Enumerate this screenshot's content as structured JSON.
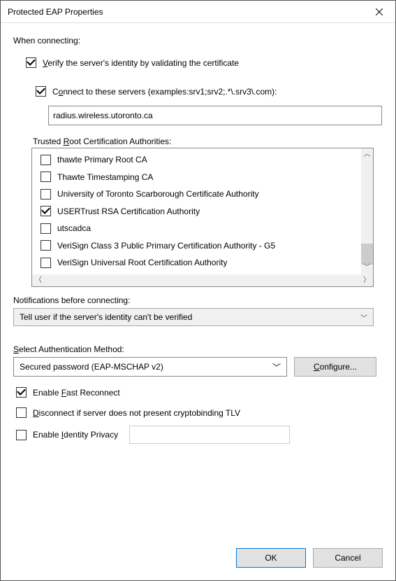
{
  "title": "Protected EAP Properties",
  "whenConnecting": "When connecting:",
  "verify": {
    "checked": true,
    "pre": "",
    "u": "V",
    "post": "erify the server's identity by validating the certificate"
  },
  "connectServers": {
    "checked": true,
    "pre": "C",
    "u": "o",
    "post": "nnect to these servers (examples:srv1;srv2;.*\\.srv3\\.com):"
  },
  "serversValue": "radius.wireless.utoronto.ca",
  "trustedRootLabel": {
    "pre": "Trusted ",
    "u": "R",
    "post": "oot Certification Authorities:"
  },
  "caList": [
    {
      "checked": false,
      "label": "thawte Primary Root CA"
    },
    {
      "checked": false,
      "label": "Thawte Timestamping CA"
    },
    {
      "checked": false,
      "label": "University of Toronto Scarborough Certificate Authority"
    },
    {
      "checked": true,
      "label": "USERTrust RSA Certification Authority"
    },
    {
      "checked": false,
      "label": "utscadca"
    },
    {
      "checked": false,
      "label": "VeriSign Class 3 Public Primary Certification Authority - G5"
    },
    {
      "checked": false,
      "label": "VeriSign Universal Root Certification Authority"
    }
  ],
  "notifLabel": "Notifications before connecting:",
  "notifValue": "Tell user if the server's identity can't be verified",
  "selectMethodLabel": {
    "pre": "",
    "u": "S",
    "post": "elect Authentication Method:"
  },
  "methodValue": "Secured password (EAP-MSCHAP v2)",
  "configure": {
    "pre": "",
    "u": "C",
    "post": "onfigure..."
  },
  "fastReconnect": {
    "checked": true,
    "pre": "Enable ",
    "u": "F",
    "post": "ast Reconnect"
  },
  "disconnect": {
    "checked": false,
    "pre": "",
    "u": "D",
    "post": "isconnect if server does not present cryptobinding TLV"
  },
  "identityPrivacy": {
    "checked": false,
    "pre": "Enable ",
    "u": "I",
    "post": "dentity Privacy"
  },
  "ok": "OK",
  "cancel": "Cancel"
}
